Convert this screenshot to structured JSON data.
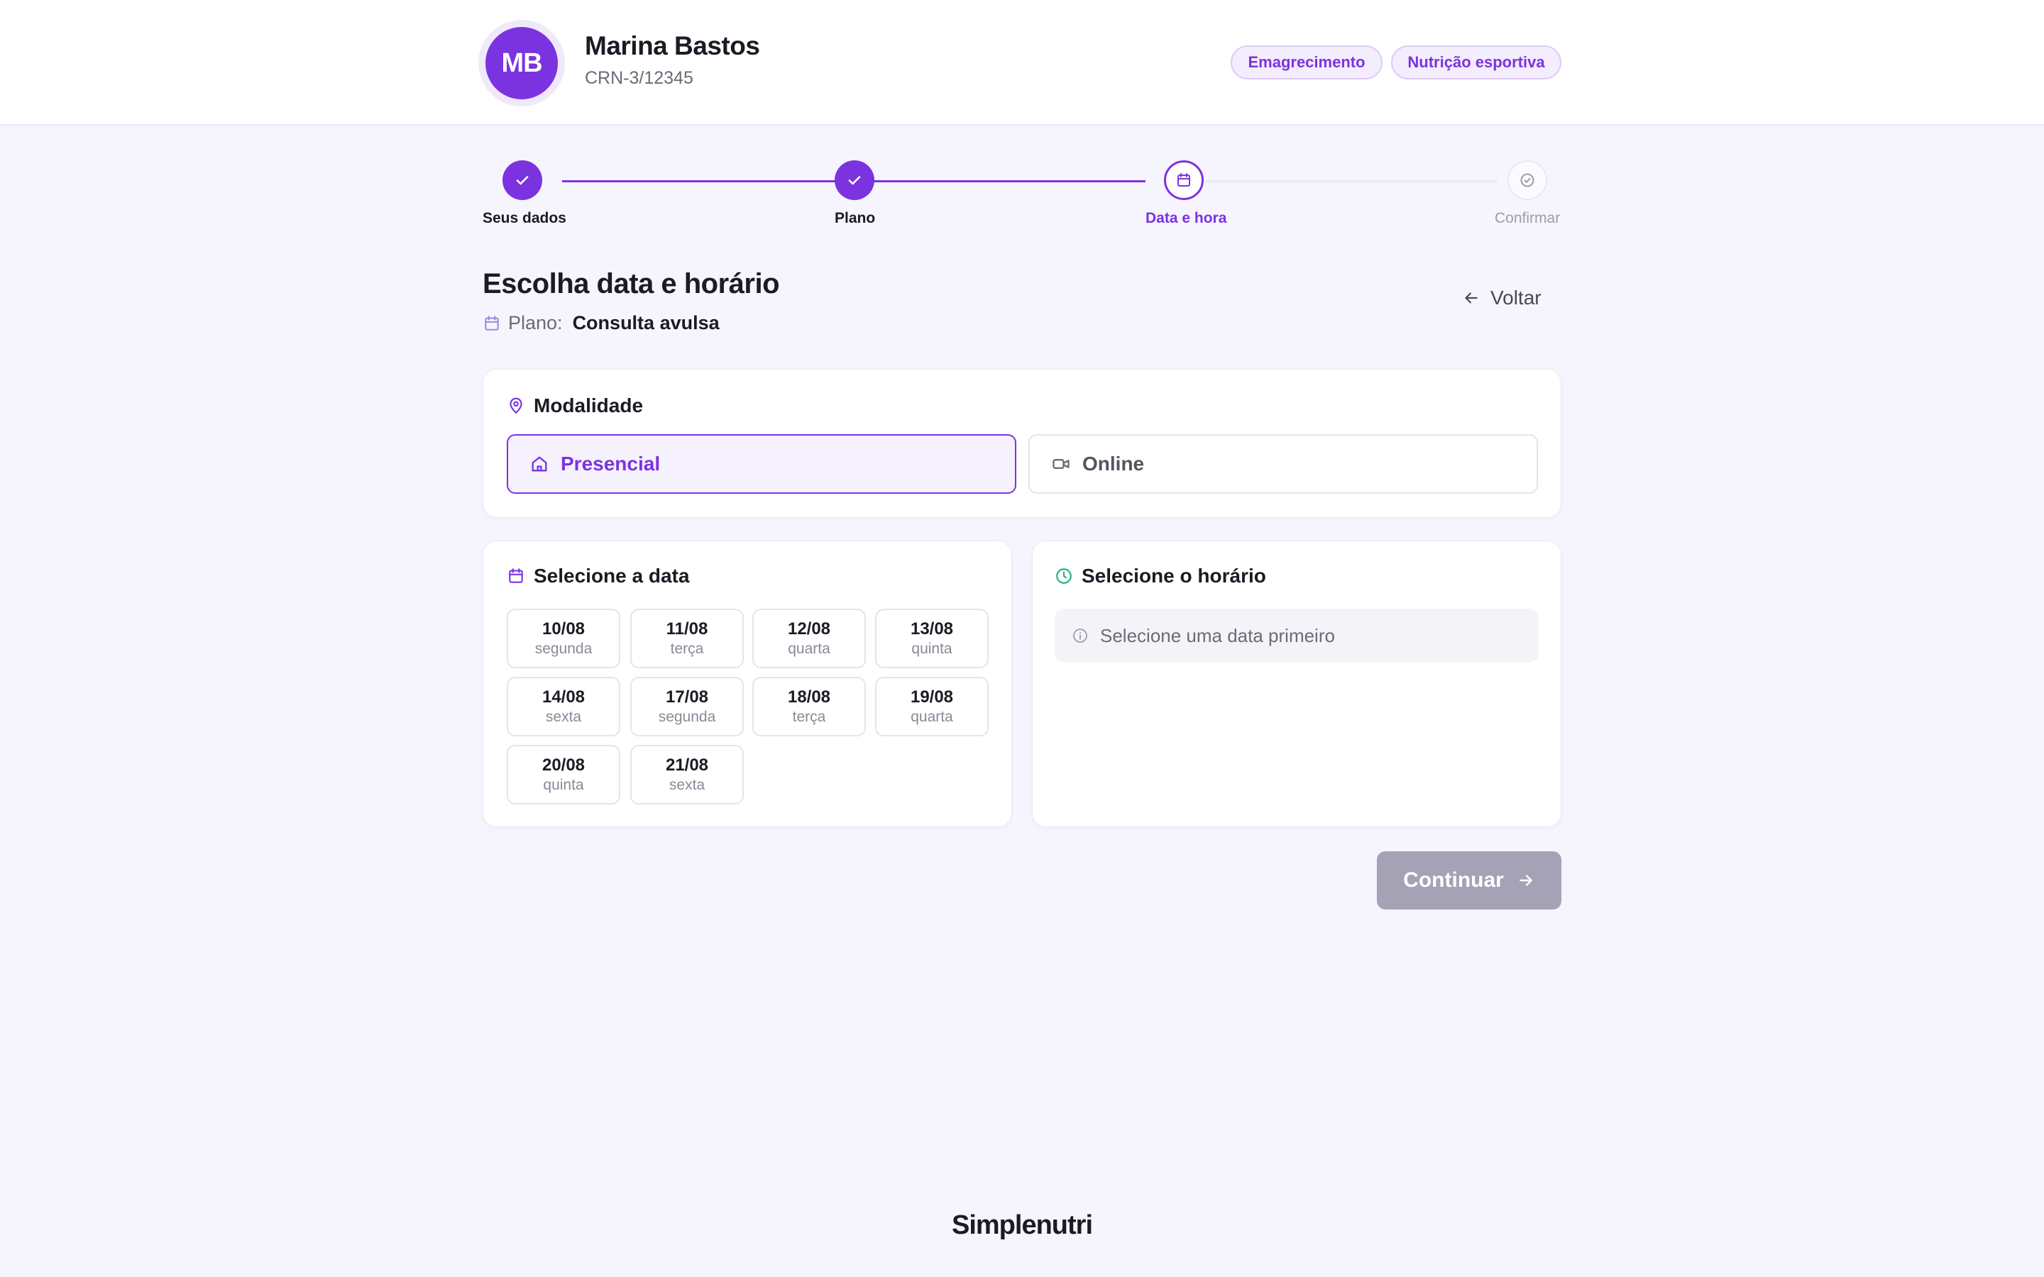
{
  "header": {
    "avatar_initials": "MB",
    "doctor_name": "Marina Bastos",
    "doctor_crn": "CRN-3/12345",
    "tags": [
      "Emagrecimento",
      "Nutrição esportiva"
    ]
  },
  "stepper": {
    "steps": [
      {
        "label": "Seus dados",
        "state": "done"
      },
      {
        "label": "Plano",
        "state": "done"
      },
      {
        "label": "Data e hora",
        "state": "current"
      },
      {
        "label": "Confirmar",
        "state": "pending"
      }
    ]
  },
  "page": {
    "title": "Escolha data e horário",
    "plan_prefix": "Plano:",
    "plan_name": "Consulta avulsa",
    "back_label": "Voltar"
  },
  "modality": {
    "title": "Modalidade",
    "options": [
      {
        "label": "Presencial",
        "selected": true
      },
      {
        "label": "Online",
        "selected": false
      }
    ]
  },
  "date_picker": {
    "title": "Selecione a data",
    "dates": [
      {
        "day": "10/08",
        "weekday": "segunda"
      },
      {
        "day": "11/08",
        "weekday": "terça"
      },
      {
        "day": "12/08",
        "weekday": "quarta"
      },
      {
        "day": "13/08",
        "weekday": "quinta"
      },
      {
        "day": "14/08",
        "weekday": "sexta"
      },
      {
        "day": "17/08",
        "weekday": "segunda"
      },
      {
        "day": "18/08",
        "weekday": "terça"
      },
      {
        "day": "19/08",
        "weekday": "quarta"
      },
      {
        "day": "20/08",
        "weekday": "quinta"
      },
      {
        "day": "21/08",
        "weekday": "sexta"
      }
    ]
  },
  "time_picker": {
    "title": "Selecione o horário",
    "empty_message": "Selecione uma data primeiro"
  },
  "actions": {
    "continue_label": "Continuar"
  },
  "footer": {
    "brand": "Simplenutri"
  },
  "colors": {
    "accent": "#7b33e0",
    "background": "#f6f4fd",
    "disabled_button": "#a5a2b6",
    "clock_green": "#22b07d"
  },
  "icons": {
    "step_done": "check-icon",
    "step_current": "calendar-icon",
    "step_pending": "check-circle-icon",
    "plan": "calendar-icon",
    "back": "arrow-left-icon",
    "modality": "map-pin-icon",
    "presencial": "home-icon",
    "online": "video-icon",
    "date": "calendar-icon",
    "time": "clock-icon",
    "info": "info-icon",
    "continue": "arrow-right-icon"
  }
}
